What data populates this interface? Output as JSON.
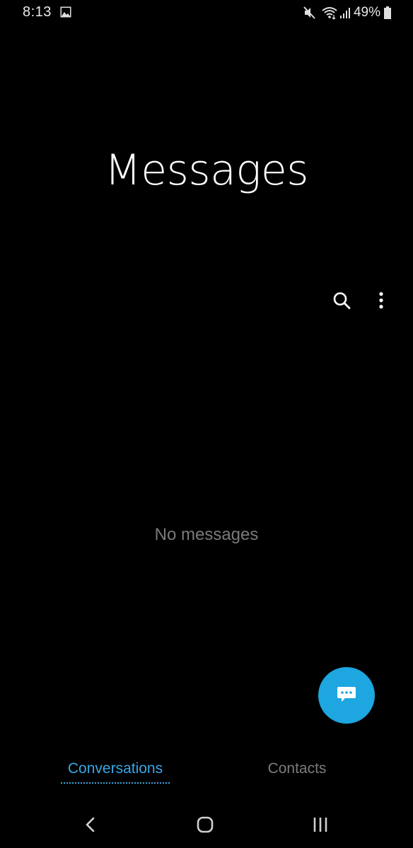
{
  "status_bar": {
    "time": "8:13",
    "battery": "49%",
    "icons": [
      "gallery-icon",
      "mute-icon",
      "wifi-icon",
      "signal-icon",
      "battery-icon"
    ]
  },
  "header": {
    "title": "Messages",
    "actions": [
      "search-icon",
      "more-options-icon"
    ]
  },
  "empty_state": {
    "text": "No messages"
  },
  "fab": {
    "icon": "compose-message-icon",
    "color": "#1da6e0"
  },
  "tabs": [
    {
      "label": "Conversations",
      "active": true,
      "color": "#3aa7e4"
    },
    {
      "label": "Contacts",
      "active": false,
      "color": "#7c7c7c"
    }
  ],
  "nav_bar": {
    "buttons": [
      "back-icon",
      "home-icon",
      "recents-icon"
    ]
  }
}
